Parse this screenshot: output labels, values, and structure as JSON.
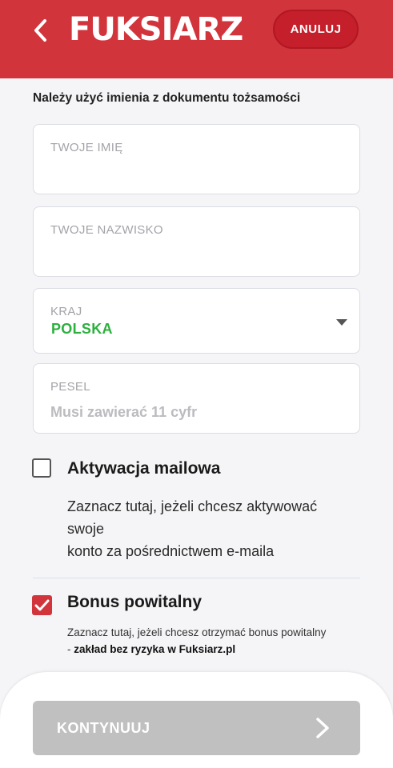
{
  "header": {
    "logo": "FUKSIARZ",
    "cancel_label": "ANULUJ",
    "brand_color": "#d2343c"
  },
  "form": {
    "hint": "Należy użyć imienia z dokumentu tożsamości",
    "first_name_label": "TWOJE IMIĘ",
    "last_name_label": "TWOJE NAZWISKO",
    "country_label": "KRAJ",
    "country_value": "POLSKA",
    "pesel_label": "PESEL",
    "pesel_placeholder": "Musi zawierać 11 cyfr"
  },
  "options": {
    "email_activation": {
      "title": "Aktywacja mailowa",
      "desc_line1": "Zaznacz tutaj, jeżeli chcesz aktywować",
      "desc_line2": "swoje",
      "desc_line3": "konto za pośrednictwem e-maila",
      "checked": false
    },
    "welcome_bonus": {
      "title": "Bonus powitalny",
      "desc": "Zaznacz tutaj, jeżeli chcesz otrzymać bonus powitalny",
      "desc_prefix": "- ",
      "desc_bold": "zakład bez ryzyka w Fuksiarz.pl",
      "checked": true
    }
  },
  "footer": {
    "continue_label": "KONTYNUUJ"
  }
}
